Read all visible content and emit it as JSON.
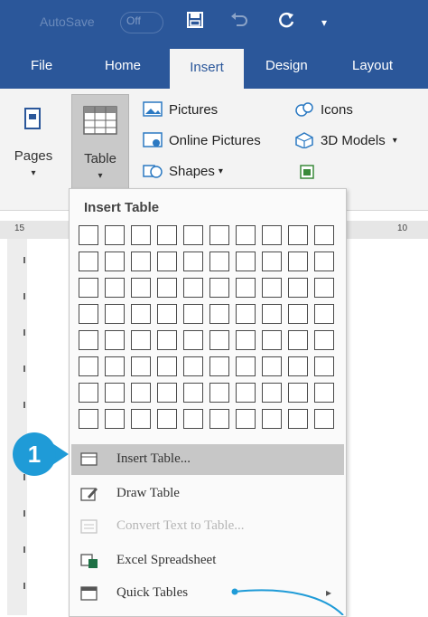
{
  "title_bar": {
    "autosave_label": "AutoSave",
    "autosave_state": "Off"
  },
  "tabs": [
    {
      "label": "File"
    },
    {
      "label": "Home"
    },
    {
      "label": "Insert"
    },
    {
      "label": "Design"
    },
    {
      "label": "Layout"
    }
  ],
  "ribbon": {
    "pages_label": "Pages",
    "table_label": "Table",
    "pictures": "Pictures",
    "online_pictures": "Online Pictures",
    "shapes": "Shapes",
    "icons": "Icons",
    "models_3d": "3D Models"
  },
  "ruler": {
    "left_mark": "15",
    "right_mark": "10"
  },
  "dropdown": {
    "title": "Insert Table",
    "grid_columns": 10,
    "grid_rows": 8,
    "items": [
      {
        "label": "Insert Table...",
        "icon": "insert-table-icon",
        "state": "highlighted"
      },
      {
        "label": "Draw Table",
        "icon": "draw-table-icon",
        "state": "normal"
      },
      {
        "label": "Convert Text to Table...",
        "icon": "convert-text-icon",
        "state": "disabled"
      },
      {
        "label": "Excel Spreadsheet",
        "icon": "excel-icon",
        "state": "normal"
      },
      {
        "label": "Quick Tables",
        "icon": "quick-tables-icon",
        "state": "normal"
      }
    ]
  },
  "step_badge": {
    "number": "1"
  },
  "colors": {
    "accent": "#2b579a",
    "badge": "#1f9bd7",
    "highlight": "#c7c7c7"
  }
}
